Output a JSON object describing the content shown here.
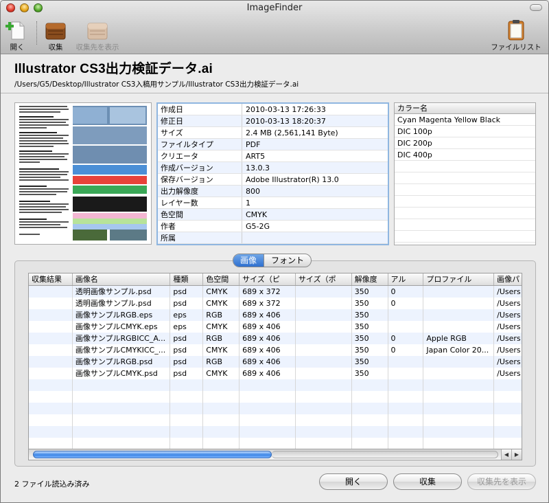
{
  "window": {
    "title": "ImageFinder"
  },
  "toolbar": {
    "open_label": "開く",
    "collect_label": "収集",
    "show_dest_label": "収集先を表示",
    "file_list_label": "ファイルリスト"
  },
  "file": {
    "name": "Illustrator CS3出力検証データ.ai",
    "path": "/Users/G5/Desktop/Illustrator CS3入稿用サンプル/Illustrator CS3出力検証データ.ai"
  },
  "properties": [
    {
      "key": "作成日",
      "value": "2010-03-13 17:26:33"
    },
    {
      "key": "修正日",
      "value": "2010-03-13 18:20:37"
    },
    {
      "key": "サイズ",
      "value": "2.4 MB (2,561,141 Byte)"
    },
    {
      "key": "ファイルタイプ",
      "value": "PDF"
    },
    {
      "key": "クリエータ",
      "value": "ART5"
    },
    {
      "key": "作成バージョン",
      "value": "13.0.3"
    },
    {
      "key": "保存バージョン",
      "value": "Adobe Illustrator(R) 13.0"
    },
    {
      "key": "出力解像度",
      "value": "800"
    },
    {
      "key": "レイヤー数",
      "value": "1"
    },
    {
      "key": "色空間",
      "value": "CMYK"
    },
    {
      "key": "作者",
      "value": "G5-2G"
    },
    {
      "key": "所属",
      "value": ""
    }
  ],
  "colors": {
    "header": "カラー名",
    "items": [
      "Cyan Magenta Yellow Black",
      "DIC 100p",
      "DIC 200p",
      "DIC 400p"
    ]
  },
  "tabs": {
    "images": "画像",
    "fonts": "フォント"
  },
  "table": {
    "headers": [
      "収集結果",
      "画像名",
      "種類",
      "色空間",
      "サイズ（ピ",
      "サイズ（ポ",
      "解像度",
      "アル",
      "プロファイル",
      "画像パ"
    ],
    "rows": [
      [
        "",
        "透明画像サンプル.psd",
        "psd",
        "CMYK",
        "689 x 372",
        "",
        "350",
        "0",
        "",
        "/Users"
      ],
      [
        "",
        "透明画像サンプル.psd",
        "psd",
        "CMYK",
        "689 x 372",
        "",
        "350",
        "0",
        "",
        "/Users"
      ],
      [
        "",
        "画像サンプルRGB.eps",
        "eps",
        "RGB",
        "689 x 406",
        "",
        "350",
        "",
        "",
        "/Users"
      ],
      [
        "",
        "画像サンプルCMYK.eps",
        "eps",
        "CMYK",
        "689 x 406",
        "",
        "350",
        "",
        "",
        "/Users"
      ],
      [
        "",
        "画像サンプルRGBICC_A...",
        "psd",
        "RGB",
        "689 x 406",
        "",
        "350",
        "0",
        "Apple RGB",
        "/Users"
      ],
      [
        "",
        "画像サンプルCMYKICC_...",
        "psd",
        "CMYK",
        "689 x 406",
        "",
        "350",
        "0",
        "Japan Color 20...",
        "/Users"
      ],
      [
        "",
        "画像サンプルRGB.psd",
        "psd",
        "RGB",
        "689 x 406",
        "",
        "350",
        "",
        "",
        "/Users"
      ],
      [
        "",
        "画像サンプルCMYK.psd",
        "psd",
        "CMYK",
        "689 x 406",
        "",
        "350",
        "",
        "",
        "/Users"
      ]
    ]
  },
  "status": {
    "text": "2 ファイル読込み済み"
  },
  "buttons": {
    "open": "開く",
    "collect": "収集",
    "show_dest": "収集先を表示"
  }
}
